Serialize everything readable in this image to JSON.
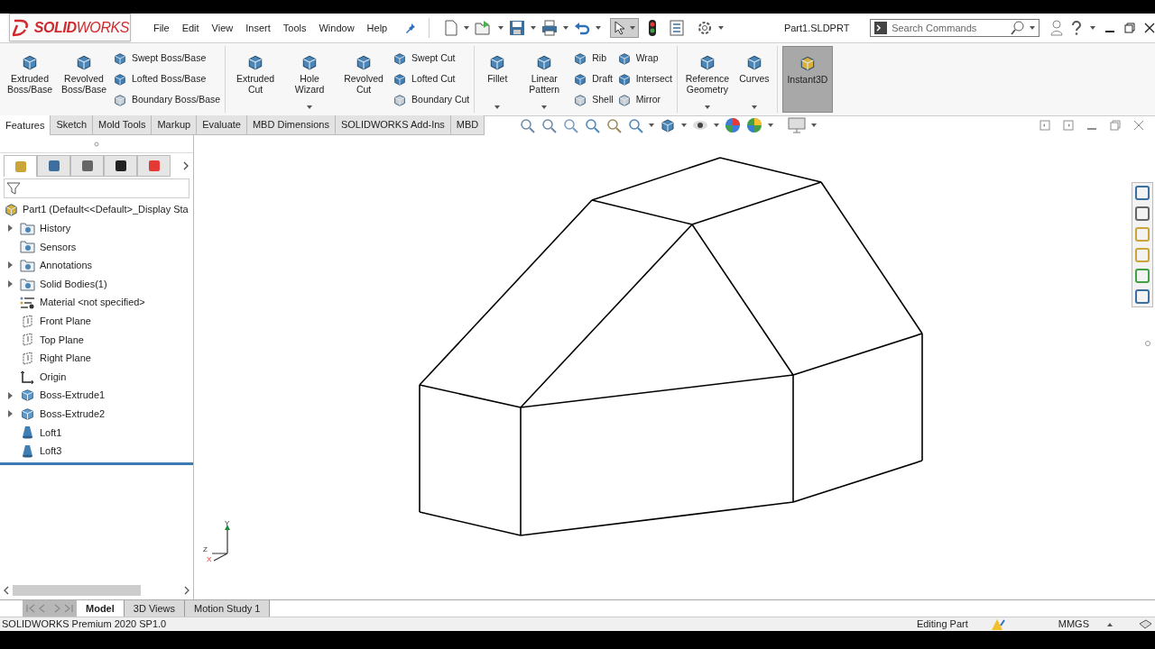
{
  "logo": {
    "text": "**SOLID**WORKS"
  },
  "menu": [
    "File",
    "Edit",
    "View",
    "Insert",
    "Tools",
    "Window",
    "Help"
  ],
  "document_title": "Part1.SLDPRT",
  "search": {
    "placeholder": "Search Commands"
  },
  "ribbon": {
    "groups": [
      {
        "columns": [
          {
            "kind": "large",
            "label": "Extruded Boss/Base",
            "dropdown": false
          },
          {
            "kind": "large",
            "label": "Revolved Boss/Base",
            "dropdown": false
          },
          {
            "kind": "stack",
            "items": [
              "Swept Boss/Base",
              "Lofted Boss/Base",
              "Boundary Boss/Base"
            ]
          }
        ]
      },
      {
        "columns": [
          {
            "kind": "large",
            "label": "Extruded Cut",
            "dropdown": false
          },
          {
            "kind": "large",
            "label": "Hole Wizard",
            "dropdown": true
          },
          {
            "kind": "large",
            "label": "Revolved Cut",
            "dropdown": false
          },
          {
            "kind": "stack",
            "items": [
              "Swept Cut",
              "Lofted Cut",
              "Boundary Cut"
            ]
          }
        ]
      },
      {
        "columns": [
          {
            "kind": "large",
            "label": "Fillet",
            "dropdown": true
          },
          {
            "kind": "large",
            "label": "Linear Pattern",
            "dropdown": true
          },
          {
            "kind": "stack",
            "items": [
              "Rib",
              "Draft",
              "Shell"
            ]
          },
          {
            "kind": "stack",
            "items": [
              "Wrap",
              "Intersect",
              "Mirror"
            ]
          }
        ]
      },
      {
        "columns": [
          {
            "kind": "large",
            "label": "Reference Geometry",
            "dropdown": true
          },
          {
            "kind": "large",
            "label": "Curves",
            "dropdown": true
          }
        ]
      },
      {
        "columns": [
          {
            "kind": "large",
            "label": "Instant3D",
            "dropdown": false,
            "selected": true
          }
        ]
      }
    ]
  },
  "command_tabs": [
    {
      "label": "Features",
      "selected": true
    },
    {
      "label": "Sketch",
      "selected": false
    },
    {
      "label": "Mold Tools",
      "selected": false
    },
    {
      "label": "Markup",
      "selected": false
    },
    {
      "label": "Evaluate",
      "selected": false
    },
    {
      "label": "MBD Dimensions",
      "selected": false
    },
    {
      "label": "SOLIDWORKS Add-Ins",
      "selected": false
    },
    {
      "label": "MBD",
      "selected": false
    }
  ],
  "feature_tree": {
    "root": "Part1  (Default<<Default>_Display Sta",
    "items": [
      {
        "label": "History",
        "kind": "folder",
        "collapsed": true
      },
      {
        "label": "Sensors",
        "kind": "folder",
        "collapsed": false
      },
      {
        "label": "Annotations",
        "kind": "folder",
        "collapsed": true
      },
      {
        "label": "Solid Bodies(1)",
        "kind": "folder",
        "collapsed": true
      },
      {
        "label": "Material <not specified>",
        "kind": "material",
        "collapsed": false
      },
      {
        "label": "Front Plane",
        "kind": "plane",
        "collapsed": false
      },
      {
        "label": "Top Plane",
        "kind": "plane",
        "collapsed": false
      },
      {
        "label": "Right Plane",
        "kind": "plane",
        "collapsed": false
      },
      {
        "label": "Origin",
        "kind": "origin",
        "collapsed": false
      },
      {
        "label": "Boss-Extrude1",
        "kind": "extrude",
        "collapsed": true
      },
      {
        "label": "Boss-Extrude2",
        "kind": "extrude",
        "collapsed": true
      },
      {
        "label": "Loft1",
        "kind": "loft",
        "collapsed": false
      },
      {
        "label": "Loft3",
        "kind": "loft",
        "collapsed": false
      }
    ]
  },
  "panel_tabs": [
    {
      "selected": true
    },
    {
      "selected": false
    },
    {
      "selected": false
    },
    {
      "selected": false
    },
    {
      "selected": false
    }
  ],
  "triad": [
    "Y",
    "Z",
    "X"
  ],
  "bottom_tabs": [
    {
      "label": "Model",
      "selected": true
    },
    {
      "label": "3D Views",
      "selected": false
    },
    {
      "label": "Motion Study 1",
      "selected": false
    }
  ],
  "status_bar": {
    "product": "SOLIDWORKS Premium 2020 SP1.0",
    "mode": "Editing Part",
    "units": "MMGS"
  }
}
